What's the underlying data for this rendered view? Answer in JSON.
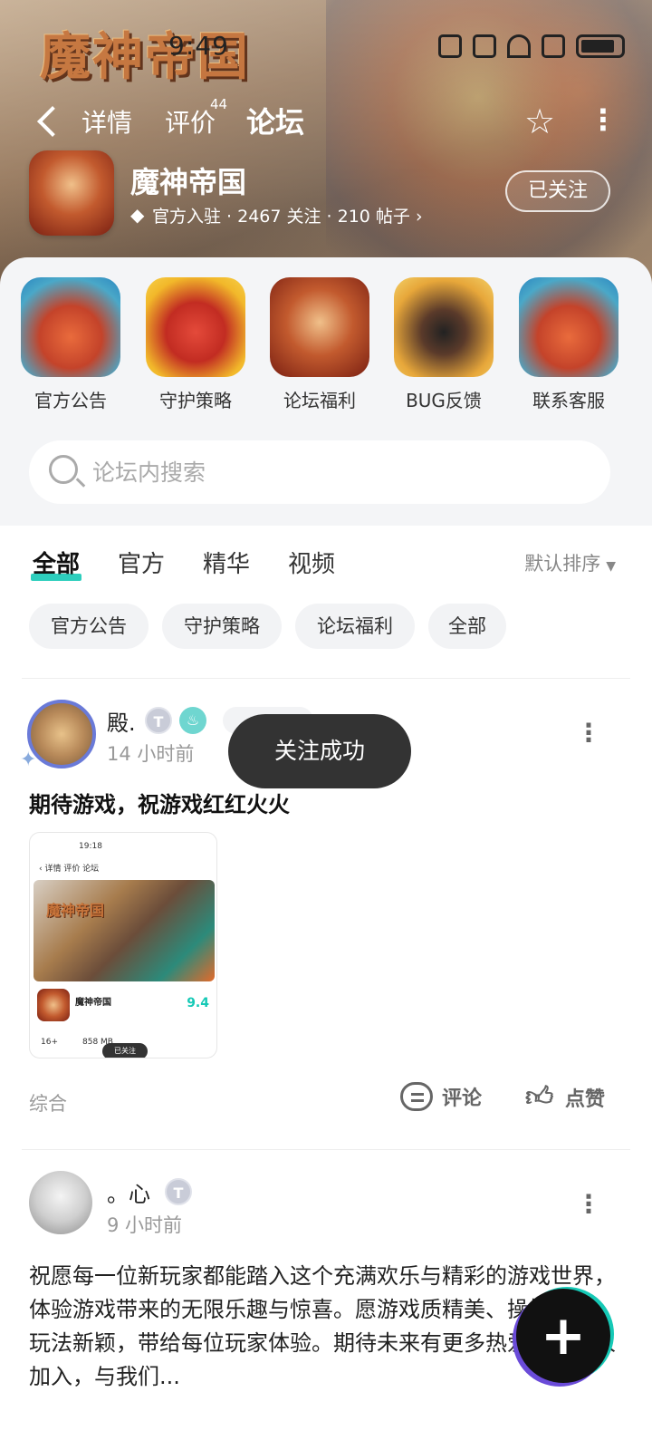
{
  "status": {
    "time": "9:49"
  },
  "banner": {
    "logo_text": "魔神帝国"
  },
  "nav": {
    "tabs": [
      {
        "label": "详情"
      },
      {
        "label": "评价",
        "count": "44"
      },
      {
        "label": "论坛"
      }
    ],
    "star_icon": "star-outline-icon",
    "more_icon": "more-vertical-icon"
  },
  "app": {
    "name": "魔神帝国",
    "meta": "官方入驻 · 2467 关注 · 210 帖子 ›",
    "follow_label": "已关注"
  },
  "shortcuts": [
    {
      "label": "官方公告"
    },
    {
      "label": "守护策略"
    },
    {
      "label": "论坛福利"
    },
    {
      "label": "BUG反馈"
    },
    {
      "label": "联系客服"
    }
  ],
  "search": {
    "placeholder": "论坛内搜索"
  },
  "feed": {
    "tabs": [
      {
        "label": "全部"
      },
      {
        "label": "官方"
      },
      {
        "label": "精华"
      },
      {
        "label": "视频"
      }
    ],
    "sort_label": "默认排序",
    "chips": [
      {
        "label": "官方公告"
      },
      {
        "label": "守护策略"
      },
      {
        "label": "论坛福利"
      },
      {
        "label": "全部"
      }
    ]
  },
  "posts": [
    {
      "username": "殿.",
      "badge": "T",
      "time": "14 小时前",
      "title": "期待游戏，祝游戏红红火火",
      "screenshot": {
        "time": "19:18",
        "tabs": "‹ 详情   评价   论坛",
        "logo": "魔神帝国",
        "app_name": "魔神帝国",
        "score": "9.4",
        "age": "16+",
        "size": "858 MB",
        "followed": "已关注"
      },
      "tag": "综合",
      "comment_label": "评论",
      "like_label": "点赞"
    },
    {
      "username": "。心",
      "badge": "T",
      "time": "9 小时前",
      "body": "祝愿每一位新玩家都能踏入这个充满欢乐与精彩的游戏世界，体验游戏带来的无限乐趣与惊喜。愿游戏质精美、操控流畅、玩法新颖，带给每位玩家体验。期待未来有更多热爱游戏的人加入，与我们..."
    }
  ],
  "toast": "关注成功",
  "fab": {
    "icon": "plus-icon"
  }
}
